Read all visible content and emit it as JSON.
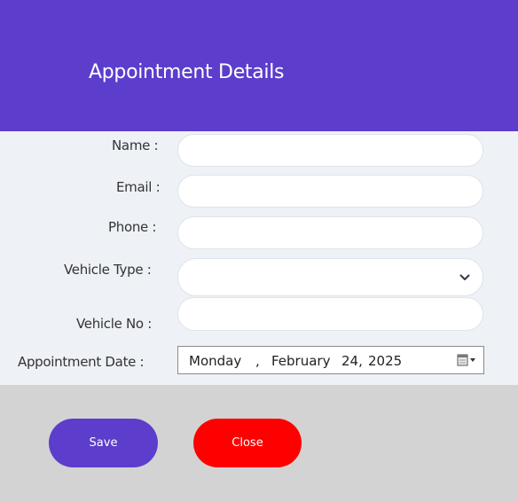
{
  "header": {
    "title": "Appointment Details"
  },
  "form": {
    "name_label": "Name :",
    "email_label": "Email :",
    "phone_label": "Phone :",
    "vehicle_type_label": "Vehicle Type :",
    "vehicle_no_label": "Vehicle No :",
    "appointment_date_label": "Appointment Date :",
    "name_value": "",
    "email_value": "",
    "phone_value": "",
    "vehicle_type_value": "",
    "vehicle_no_value": "",
    "date": {
      "weekday": "Monday",
      "separator": ",",
      "month": "February",
      "day": "24,",
      "year": "2025"
    }
  },
  "buttons": {
    "save_label": "Save",
    "close_label": "Close"
  },
  "colors": {
    "accent": "#5c3dcc",
    "close": "#ff0000",
    "form_bg": "#eef1f6",
    "footer_bg": "#d3d3d3"
  },
  "icons": {
    "select": "chevron-down-icon",
    "date": "calendar-icon"
  }
}
